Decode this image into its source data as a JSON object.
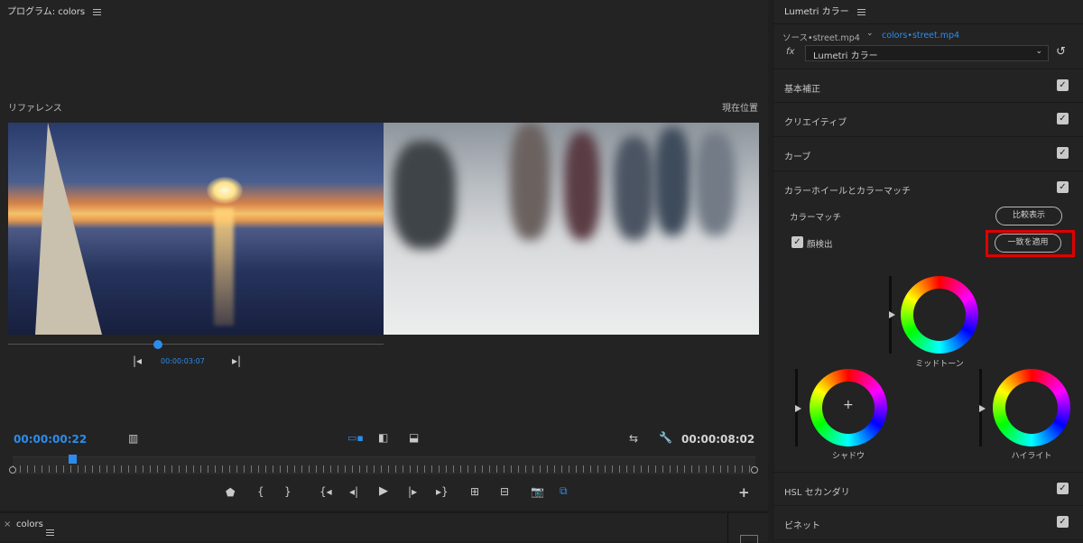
{
  "program": {
    "title": "プログラム: colors",
    "reference_label": "リファレンス",
    "current_label": "現在位置",
    "scrub_timecode": "00:00:03:07",
    "scrub_progress": 0.4,
    "timecode_current": "00:00:00:22",
    "timecode_duration": "00:00:08:02",
    "timeline_position": 0.08,
    "accent_color": "#2d8ceb"
  },
  "bottom": {
    "tab_close": "×",
    "tab_title": "colors"
  },
  "lumetri": {
    "title": "Lumetri カラー",
    "source_clip": "ソース•street.mp4",
    "target_clip": "colors•street.mp4",
    "fx_label": "fx",
    "effect_select": "Lumetri カラー",
    "sections": [
      {
        "label": "基本補正",
        "checked": true
      },
      {
        "label": "クリエイティブ",
        "checked": true
      },
      {
        "label": "カーブ",
        "checked": true
      },
      {
        "label": "カラーホイールとカラーマッチ",
        "checked": true
      },
      {
        "label": "HSL セカンダリ",
        "checked": true
      },
      {
        "label": "ビネット",
        "checked": true
      }
    ],
    "color_match_label": "カラーマッチ",
    "compare_button": "比較表示",
    "face_detect_label": "顔検出",
    "apply_match_button": "一致を適用",
    "highlight_color": "#e00000",
    "wheels": {
      "midtone": "ミッドトーン",
      "shadow": "シャドウ",
      "highlight": "ハイライト"
    }
  }
}
